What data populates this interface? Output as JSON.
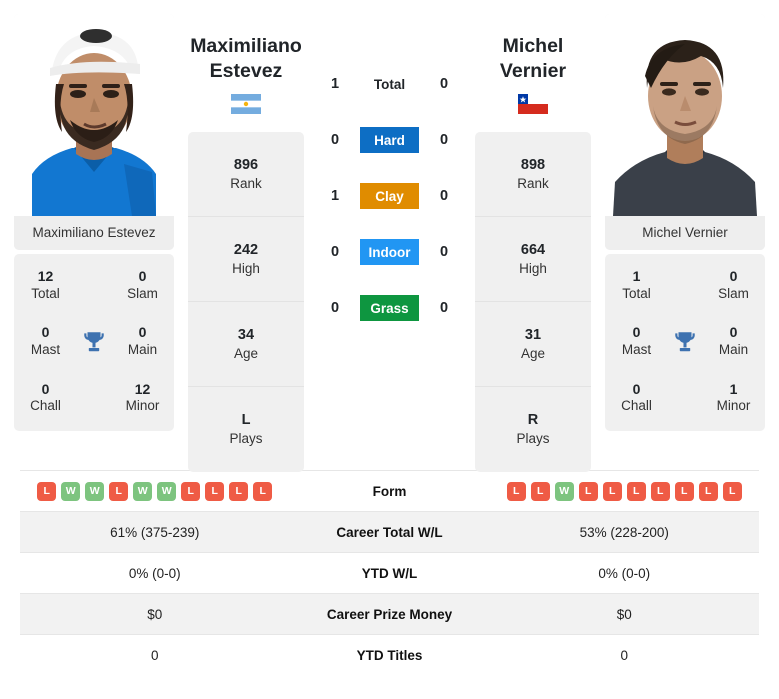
{
  "players": {
    "left": {
      "name_line1": "Maximiliano",
      "name_line2": "Estevez",
      "full_name": "Maximiliano Estevez",
      "photo_caption": "Maximiliano Estevez",
      "country": "Argentina",
      "flag": "argentina-flag",
      "stats": [
        {
          "value": "896",
          "label": "Rank"
        },
        {
          "value": "242",
          "label": "High"
        },
        {
          "value": "34",
          "label": "Age"
        },
        {
          "value": "L",
          "label": "Plays"
        }
      ],
      "titles": [
        {
          "value": "12",
          "label": "Total"
        },
        {
          "value": "0",
          "label": "Slam"
        },
        {
          "value": "0",
          "label": "Mast"
        },
        {
          "value": "0",
          "label": "Main"
        },
        {
          "value": "0",
          "label": "Chall"
        },
        {
          "value": "12",
          "label": "Minor"
        }
      ],
      "form": [
        "L",
        "W",
        "W",
        "L",
        "W",
        "W",
        "L",
        "L",
        "L",
        "L"
      ],
      "career_total_wl": "61% (375-239)",
      "ytd_wl": "0% (0-0)",
      "career_prize_money": "$0",
      "ytd_titles": "0"
    },
    "right": {
      "name_line1": "Michel",
      "name_line2": "Vernier",
      "full_name": "Michel Vernier",
      "photo_caption": "Michel Vernier",
      "country": "Chile",
      "flag": "chile-flag",
      "stats": [
        {
          "value": "898",
          "label": "Rank"
        },
        {
          "value": "664",
          "label": "High"
        },
        {
          "value": "31",
          "label": "Age"
        },
        {
          "value": "R",
          "label": "Plays"
        }
      ],
      "titles": [
        {
          "value": "1",
          "label": "Total"
        },
        {
          "value": "0",
          "label": "Slam"
        },
        {
          "value": "0",
          "label": "Mast"
        },
        {
          "value": "0",
          "label": "Main"
        },
        {
          "value": "0",
          "label": "Chall"
        },
        {
          "value": "1",
          "label": "Minor"
        }
      ],
      "form": [
        "L",
        "L",
        "W",
        "L",
        "L",
        "L",
        "L",
        "L",
        "L",
        "L"
      ],
      "career_total_wl": "53% (228-200)",
      "ytd_wl": "0% (0-0)",
      "career_prize_money": "$0",
      "ytd_titles": "0"
    }
  },
  "head_to_head": {
    "rows": [
      {
        "label": "Total",
        "left": "1",
        "right": "0",
        "style": "total",
        "color": ""
      },
      {
        "label": "Hard",
        "left": "0",
        "right": "0",
        "style": "hard",
        "color": "#0d6ec4"
      },
      {
        "label": "Clay",
        "left": "1",
        "right": "0",
        "style": "clay",
        "color": "#e08c00"
      },
      {
        "label": "Indoor",
        "left": "0",
        "right": "0",
        "style": "indoor",
        "color": "#2196f3"
      },
      {
        "label": "Grass",
        "left": "0",
        "right": "0",
        "style": "grass",
        "color": "#0e9640"
      }
    ]
  },
  "comparison_table": {
    "rows": [
      {
        "label": "Form",
        "type": "form"
      },
      {
        "label": "Career Total W/L",
        "type": "text",
        "key": "career_total_wl"
      },
      {
        "label": "YTD W/L",
        "type": "text",
        "key": "ytd_wl"
      },
      {
        "label": "Career Prize Money",
        "type": "text",
        "key": "career_prize_money"
      },
      {
        "label": "YTD Titles",
        "type": "text",
        "key": "ytd_titles"
      }
    ]
  },
  "colors": {
    "win": "#7dc47f",
    "loss": "#ef5b45",
    "card_bg": "#f0f0f0",
    "row_shade": "#f2f2f2"
  },
  "icons": {
    "trophy": "trophy-icon"
  }
}
